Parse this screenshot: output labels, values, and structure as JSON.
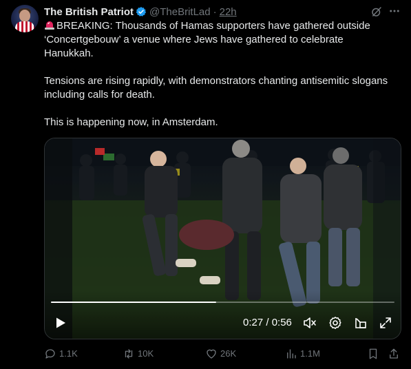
{
  "tweet": {
    "author_name": "The British Patriot",
    "handle": "@TheBritLad",
    "separator": "·",
    "time": "22h",
    "paragraph1": "BREAKING: Thousands of Hamas supporters have gathered outside ‘Concertgebouw’ a venue where Jews have gathered to celebrate Hanukkah.",
    "paragraph2": "Tensions are rising rapidly, with demonstrators chanting antisemitic slogans including calls for death.",
    "paragraph3": "This is happening now, in Amsterdam.",
    "leading_emoji": "siren-icon"
  },
  "video": {
    "current_time": "0:27 / 0:56",
    "progress": 0.48,
    "controls": [
      "play-icon",
      "mute-icon",
      "settings-icon",
      "pop-out-icon",
      "fullscreen-icon"
    ]
  },
  "actions": {
    "replies": "1.1K",
    "reposts": "10K",
    "likes": "26K",
    "views": "1.1M"
  },
  "colors": {
    "background": "#000000",
    "text": "#e7e9ea",
    "secondary": "#71767b",
    "verified": "#1d9bf0"
  }
}
